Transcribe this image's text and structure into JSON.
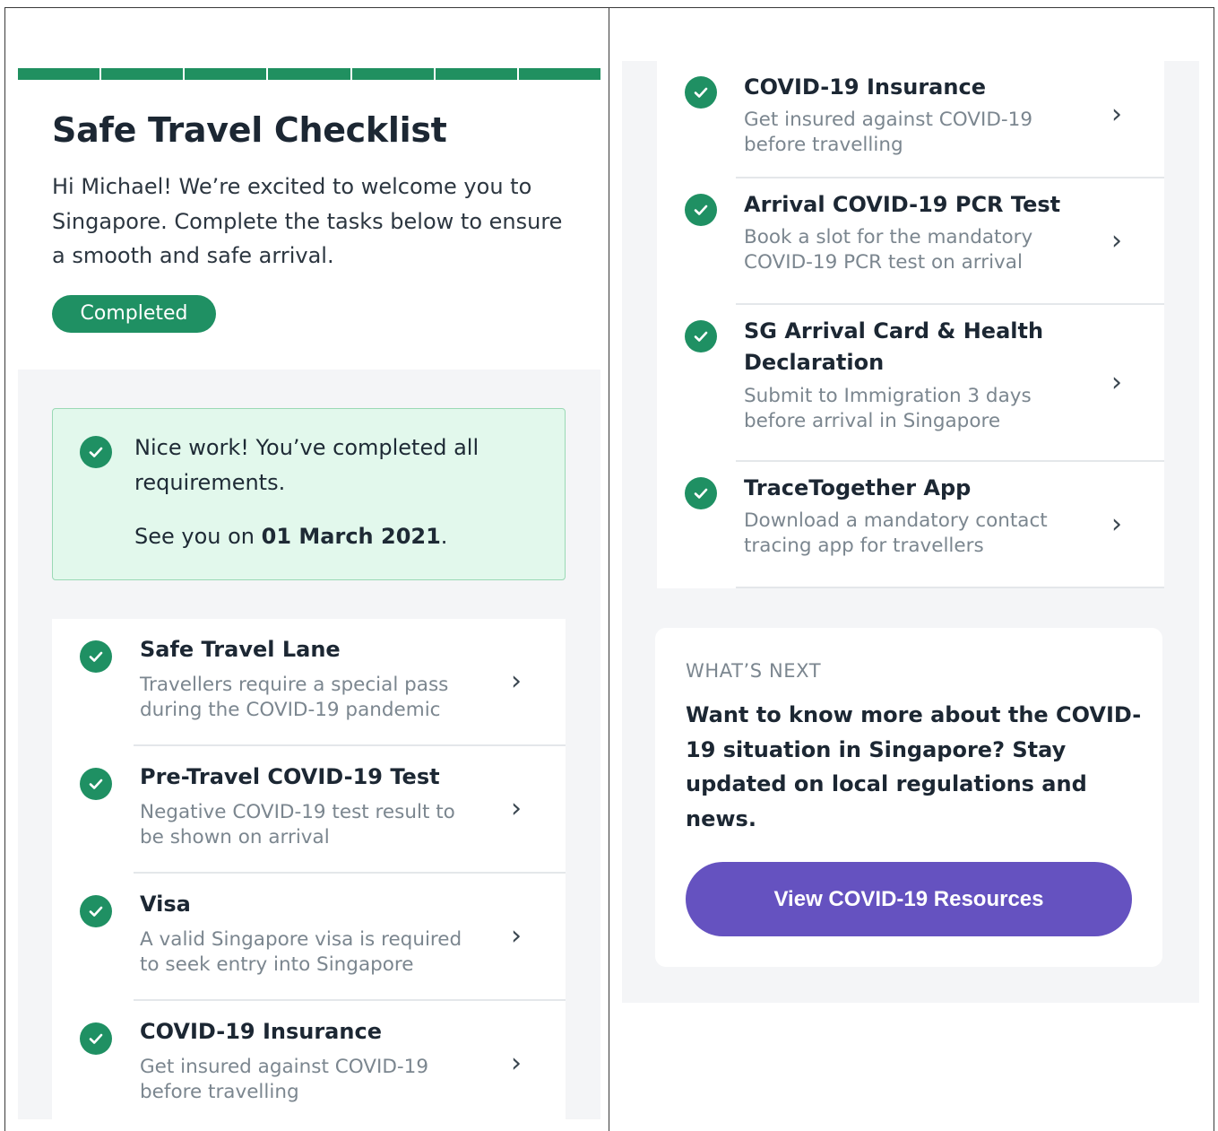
{
  "left": {
    "page_title": "Safe Travel Checklist",
    "intro": "Hi Michael! We’re excited to welcome you to Singapore. Complete the tasks below to ensure a smooth and safe arrival.",
    "status_badge": "Completed",
    "progress": {
      "segments_total": 7,
      "segments_complete": 7
    },
    "success": {
      "message": "Nice work! You’ve completed all requirements.",
      "date_prefix": "See you on ",
      "date": "01 March 2021",
      "date_suffix": "."
    },
    "tasks": [
      {
        "title": "Safe Travel Lane",
        "desc": "Travellers require a special pass during the COVID-19 pandemic"
      },
      {
        "title": "Pre-Travel COVID-19 Test",
        "desc": "Negative COVID-19 test result to be shown on arrival"
      },
      {
        "title": "Visa",
        "desc": "A valid Singapore visa is required to seek entry into Singapore"
      },
      {
        "title": "COVID-19 Insurance",
        "desc": "Get insured against COVID-19 before travelling"
      }
    ]
  },
  "right": {
    "tasks": [
      {
        "title": "COVID-19 Insurance",
        "desc": "Get insured against COVID-19 before travelling"
      },
      {
        "title": "Arrival COVID-19 PCR Test",
        "desc": "Book a slot for the mandatory COVID-19 PCR test on arrival"
      },
      {
        "title": "SG Arrival Card & Health Declaration",
        "desc": "Submit to Immigration 3 days before arrival in Singapore"
      },
      {
        "title": "TraceTogether App",
        "desc": "Download a mandatory contact tracing app for travellers"
      }
    ],
    "whats_next": {
      "label": "WHAT’S NEXT",
      "text": "Want to know more about the COVID-19 situation in Singapore? Stay updated on local regulations and news.",
      "button_label": "View COVID-19 Resources"
    }
  },
  "icons": {
    "check": "check-circle-icon",
    "chevron": "chevron-right-icon"
  },
  "colors": {
    "accent_green": "#1f9063",
    "success_bg": "#e2f8ec",
    "button_purple": "#6552c0",
    "panel_bg": "#f4f5f7"
  }
}
